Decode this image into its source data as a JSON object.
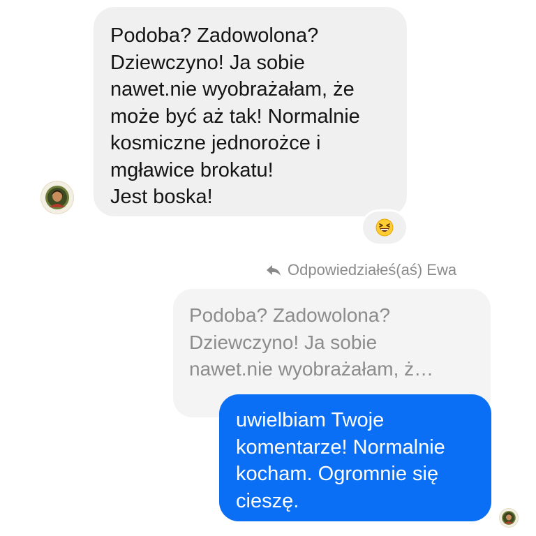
{
  "received_message": {
    "lines": [
      "Podoba? Zadowolona?",
      "Dziewczyno! Ja sobie",
      "nawet.nie wyobrażałam, że",
      "może być aż tak! Normalnie",
      "kosmiczne jednorożce i",
      "mgławice brokatu!",
      "Jest boska!"
    ],
    "reaction_icon": "grinning-squinting-face-emoji"
  },
  "reply": {
    "label": "Odpowiedziałeś(aś) Ewa",
    "icon": "reply-arrow-icon",
    "quoted_lines": [
      "Podoba? Zadowolona?",
      "Dziewczyno! Ja sobie",
      "nawet.nie wyobrażałam, ż…"
    ]
  },
  "sent_message": {
    "lines": [
      "uwielbiam Twoje",
      "komentarze! Normalnie",
      "kocham. Ogromnie się",
      "cieszę."
    ]
  },
  "colors": {
    "sent_bubble": "#0a6ff5",
    "received_bubble": "#f0f0f0",
    "meta_text": "#8a8a8a"
  }
}
